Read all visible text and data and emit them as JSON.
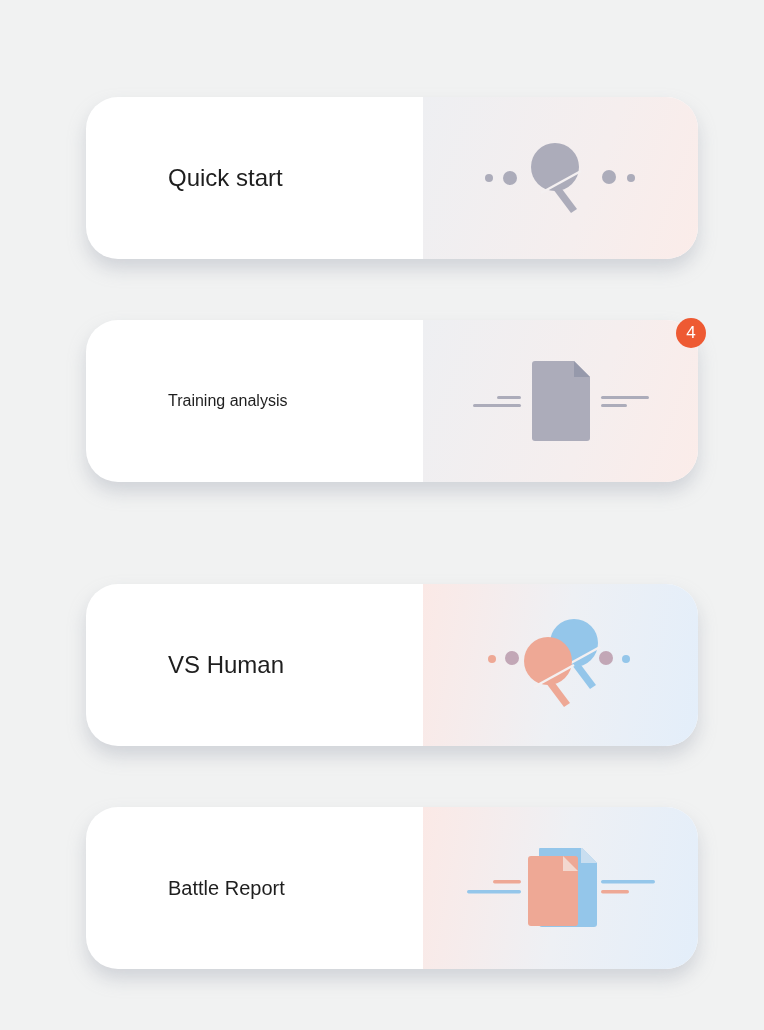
{
  "sections": [
    {
      "cards": [
        {
          "title": "Quick start",
          "kind": "paddle"
        },
        {
          "title": "Training analysis",
          "kind": "document",
          "badge": "4"
        }
      ]
    },
    {
      "cards": [
        {
          "title": "VS Human",
          "kind": "paddles"
        },
        {
          "title": "Battle Report",
          "kind": "documents"
        }
      ]
    }
  ]
}
